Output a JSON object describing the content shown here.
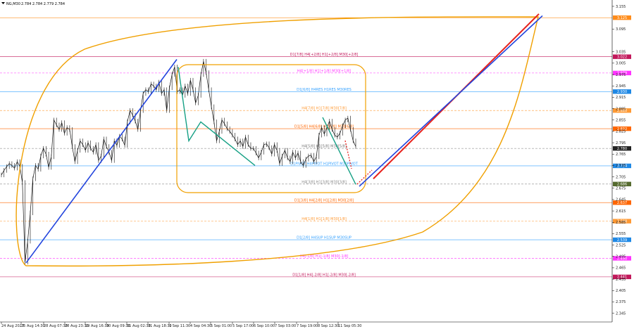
{
  "header": {
    "icon": "triangle-down-icon",
    "symbol": "NG,M30",
    "ohlc": "2.784 2.784 2.779 2.784"
  },
  "chart_data": {
    "type": "line",
    "ylim": [
      2.335,
      3.155
    ],
    "y_ticks": [
      3.155,
      3.095,
      3.035,
      3.005,
      2.975,
      2.945,
      2.915,
      2.885,
      2.855,
      2.825,
      2.795,
      2.765,
      2.735,
      2.705,
      2.675,
      2.645,
      2.615,
      2.585,
      2.555,
      2.525,
      2.495,
      2.465,
      2.435,
      2.405,
      2.375,
      2.345
    ],
    "x_labels": [
      "24 Aug 2023",
      "25 Aug 14:30",
      "28 Aug 07:30",
      "28 Aug 23:30",
      "29 Aug 16:30",
      "30 Aug 09:30",
      "31 Aug 02:30",
      "31 Aug 18:30",
      "1 Sep 11:30",
      "4 Sep 04:30",
      "5 Sep 01:00",
      "5 Sep 17:00",
      "6 Sep 10:00",
      "7 Sep 03:00",
      "7 Sep 19:00",
      "8 Sep 12:30",
      "11 Sep 05:30"
    ],
    "grid": false,
    "price_series": [
      2.71,
      2.722,
      2.732,
      2.74,
      2.735,
      2.728,
      2.745,
      2.733,
      2.69,
      2.48,
      2.535,
      2.61,
      2.7,
      2.735,
      2.725,
      2.76,
      2.78,
      2.765,
      2.73,
      2.758,
      2.855,
      2.842,
      2.83,
      2.848,
      2.82,
      2.835,
      2.83,
      2.785,
      2.745,
      2.775,
      2.8,
      2.79,
      2.775,
      2.795,
      2.78,
      2.77,
      2.79,
      2.748,
      2.76,
      2.805,
      2.785,
      2.77,
      2.748,
      2.8,
      2.788,
      2.812,
      2.805,
      2.788,
      2.85,
      2.88,
      2.868,
      2.852,
      2.83,
      2.88,
      2.925,
      2.935,
      2.93,
      2.95,
      2.945,
      2.935,
      2.955,
      2.925,
      2.935,
      2.88,
      2.94,
      2.975,
      2.995,
      2.93,
      2.935,
      2.92,
      2.945,
      2.925,
      2.96,
      2.935,
      2.9,
      2.92,
      2.975,
      3.01,
      2.98,
      2.935,
      2.89,
      2.85,
      2.8,
      2.825,
      2.855,
      2.845,
      2.832,
      2.825,
      2.815,
      2.805,
      2.79,
      2.8,
      2.785,
      2.81,
      2.79,
      2.78,
      2.78,
      2.768,
      2.755,
      2.77,
      2.79,
      2.792,
      2.782,
      2.765,
      2.79,
      2.775,
      2.74,
      2.76,
      2.775,
      2.755,
      2.745,
      2.77,
      2.755,
      2.768,
      2.745,
      2.735,
      2.752,
      2.76,
      2.762,
      2.745,
      2.758,
      2.815,
      2.835,
      2.818,
      2.835,
      2.852,
      2.83,
      2.815,
      2.81,
      2.82,
      2.84,
      2.855,
      2.86,
      2.83,
      2.8,
      2.785
    ],
    "levels": [
      {
        "price": 3.125,
        "label": "",
        "color": "#ff8c1a",
        "dash": false,
        "badge": "3.125",
        "badge_color": "#ff8c1a"
      },
      {
        "price": 3.022,
        "label": "D1[7/8] H4[+2/8] H1[+2/8] M30[+2/8]",
        "color": "#c2185b",
        "dash": false,
        "badge": "3.022",
        "badge_color": "#c2185b"
      },
      {
        "price": 2.979,
        "label": "H4[+1/8] H1[+1/8] M30[+1/8]",
        "color": "#ff33ff",
        "dash": true,
        "badge": "2.979",
        "badge_color": "#ff33ff"
      },
      {
        "price": 2.93,
        "label": "D1[6/8] H4RES H1RES M30RES",
        "color": "#33a0ff",
        "dash": false,
        "badge": "2.930",
        "badge_color": "#1e88e5"
      },
      {
        "price": 2.88,
        "label": "H4[7/8] H1[7/8] M30[7/8]",
        "color": "#ff9933",
        "dash": true,
        "badge": "2.880",
        "badge_color": "#ff9933"
      },
      {
        "price": 2.832,
        "label": "D1[5/8] H4[6/8] H1[6/8] M30[6/8]",
        "color": "#ff6600",
        "dash": false,
        "badge": "2.832",
        "badge_color": "#ff6600"
      },
      {
        "price": 2.78,
        "label": "H4[5/8] H1[5/8] M30[5/8]",
        "color": "#777777",
        "dash": true,
        "badge": "2.780",
        "badge_color": "#222222"
      },
      {
        "price": 2.734,
        "label": "D1PIVOT H4PIVOT H1PIVOT M30PIVOT",
        "color": "#33a0ff",
        "dash": false,
        "badge": "2.734",
        "badge_color": "#1e88e5"
      },
      {
        "price": 2.686,
        "label": "H4[3/8] H1[3/8] M30[3/8]",
        "color": "#888888",
        "dash": true,
        "badge": "2.686",
        "badge_color": "#556b2f"
      },
      {
        "price": 2.637,
        "label": "D1[3/8] H4[2/8] H1[2/8] M30[2/8]",
        "color": "#ff6600",
        "dash": false,
        "badge": "2.637",
        "badge_color": "#ff6600"
      },
      {
        "price": 2.588,
        "label": "H4[1/8] H1[1/8] M30[1/8]",
        "color": "#ff9933",
        "dash": true,
        "badge": "2.588",
        "badge_color": "#ff9933"
      },
      {
        "price": 2.539,
        "label": "D1[2/8] H4SUP H1SUP M30SUP",
        "color": "#33a0ff",
        "dash": false,
        "badge": "2.539",
        "badge_color": "#1e88e5"
      },
      {
        "price": 2.49,
        "label": "H4[-1/8] H1[-1/8] M30[-1/8]",
        "color": "#ff33ff",
        "dash": true,
        "badge": "2.490",
        "badge_color": "#ff33ff"
      },
      {
        "price": 2.441,
        "label": "D1[1/8] H4[-2/8] H1[-2/8] M30[-2/8]",
        "color": "#c2185b",
        "dash": false,
        "badge": "2.441",
        "badge_color": "#c2185b"
      }
    ],
    "drawings": {
      "blue_trend_1": {
        "from": [
          "25 Aug 14:30",
          2.478
        ],
        "to": [
          "1 Sep 11:30",
          3.015
        ],
        "color": "#2244dd"
      },
      "blue_trend_2": {
        "from": [
          "11 Sep 05:30",
          2.68
        ],
        "to": [
          "right",
          3.13
        ],
        "color": "#2244dd"
      },
      "red_trend": {
        "from": [
          "11 Sep 05:30",
          2.7
        ],
        "to": [
          "right",
          3.135
        ],
        "color": "#e8211c"
      },
      "green_zigzag": [
        [
          2.995
        ],
        [
          2.798
        ],
        [
          2.852
        ],
        [
          2.73
        ]
      ],
      "green_zigzag_2": [
        [
          2.862
        ],
        [
          2.685
        ]
      ],
      "box_color": "#f0a000"
    }
  }
}
